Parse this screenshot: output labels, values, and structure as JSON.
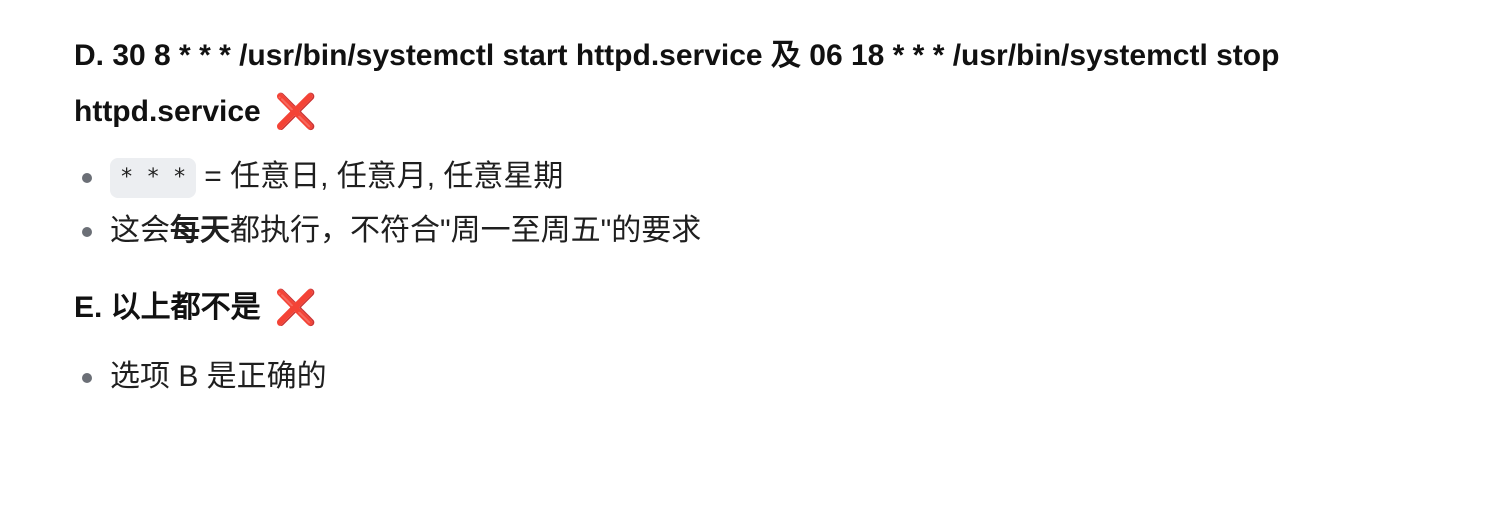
{
  "option_d": {
    "heading": "D. 30 8 * * * /usr/bin/systemctl start httpd.service 及 06 18 * * * /usr/bin/systemctl stop httpd.service",
    "mark": "❌",
    "bullets": {
      "code": "* * *",
      "wildcard_text": "= 任意日, 任意月, 任意星期",
      "every_day_prefix": "这会",
      "every_day_bold": "每天",
      "every_day_suffix": "都执行，不符合\"周一至周五\"的要求"
    }
  },
  "option_e": {
    "heading": "E. 以上都不是",
    "mark": "❌",
    "bullets": {
      "correct_text": "选项 B 是正确的"
    }
  },
  "colors": {
    "mark": "#ec4f74",
    "bullet": "#6b6f76",
    "code_bg": "#eceef1"
  }
}
